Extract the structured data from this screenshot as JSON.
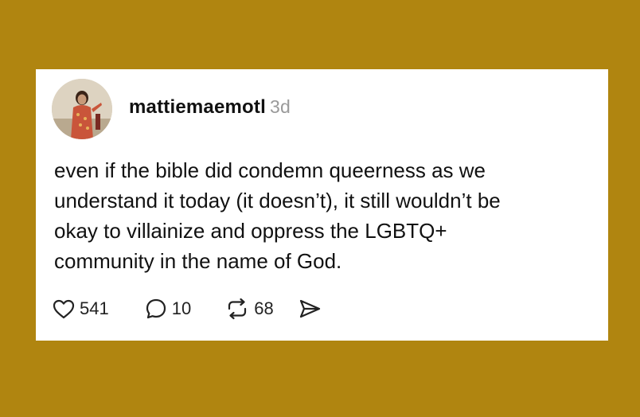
{
  "post": {
    "username": "mattiemaemotl",
    "time": "3d",
    "text": "even if the bible did condemn queerness as we\nunderstand it today (it doesn’t), it still wouldn’t be\nokay to villainize and oppress the LGBTQ+\ncommunity in the name of God.",
    "likes": "541",
    "replies": "10",
    "reposts": "68"
  },
  "icons": {
    "like": "heart-icon",
    "reply": "speech-bubble-icon",
    "repost": "repost-arrows-icon",
    "share": "send-icon"
  },
  "colors": {
    "background": "#b08510",
    "card": "#ffffff",
    "text": "#111111",
    "muted": "#9a9a9a"
  }
}
